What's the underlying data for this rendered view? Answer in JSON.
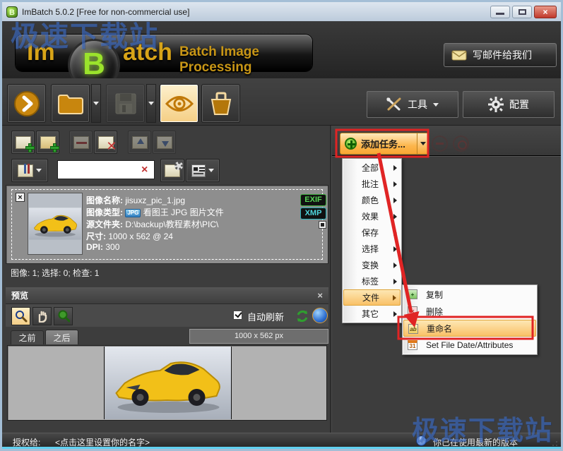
{
  "watermark": {
    "text": "极速下载站"
  },
  "titlebar": {
    "title": "ImBatch 5.0.2 [Free for non-commercial use]",
    "logo_letter": "B"
  },
  "header": {
    "logo_im": "Im",
    "logo_b": "B",
    "logo_atch": "atch",
    "tagline": "Batch Image Processing",
    "mail_button": "写邮件给我们"
  },
  "toolbar": {
    "tools": "工具",
    "config": "配置"
  },
  "icons": {
    "close": "×",
    "clear": "×",
    "check_x": "×",
    "rename_glyph": "ab",
    "calendar_glyph": "31"
  },
  "left": {
    "file_item": {
      "name_label": "图像名称:",
      "name_value": "jisuxz_pic_1.jpg",
      "type_label": "图像类型:",
      "type_badge": "JPG",
      "type_value": "看图王 JPG 图片文件",
      "folder_label": "源文件夹:",
      "folder_value": "D:\\backup\\教程素材\\PIC\\",
      "size_label": "尺寸:",
      "size_value": "1000 x 562 @ 24",
      "dpi_label": "DPI:",
      "dpi_value": "300",
      "badge_exif": "EXIF",
      "badge_xmp": "XMP"
    },
    "status": "图像: 1; 选择: 0; 检查: 1",
    "preview": {
      "title": "预览",
      "auto_refresh_label": "自动刷新",
      "tab_before": "之前",
      "tab_after": "之后",
      "size_readout": "1000 x 562 px"
    }
  },
  "right": {
    "add_task_label": "添加任务...",
    "menu": [
      "全部",
      "批注",
      "颜色",
      "效果",
      "保存",
      "选择",
      "变换",
      "标签",
      "文件",
      "其它"
    ],
    "submenu": [
      "复制",
      "删除",
      "重命名",
      "Set File Date/Attributes"
    ]
  },
  "footer": {
    "license_label": "授权给:",
    "license_value": "<点击这里设置你的名字>",
    "update_status": "你已在使用最新的版本"
  }
}
